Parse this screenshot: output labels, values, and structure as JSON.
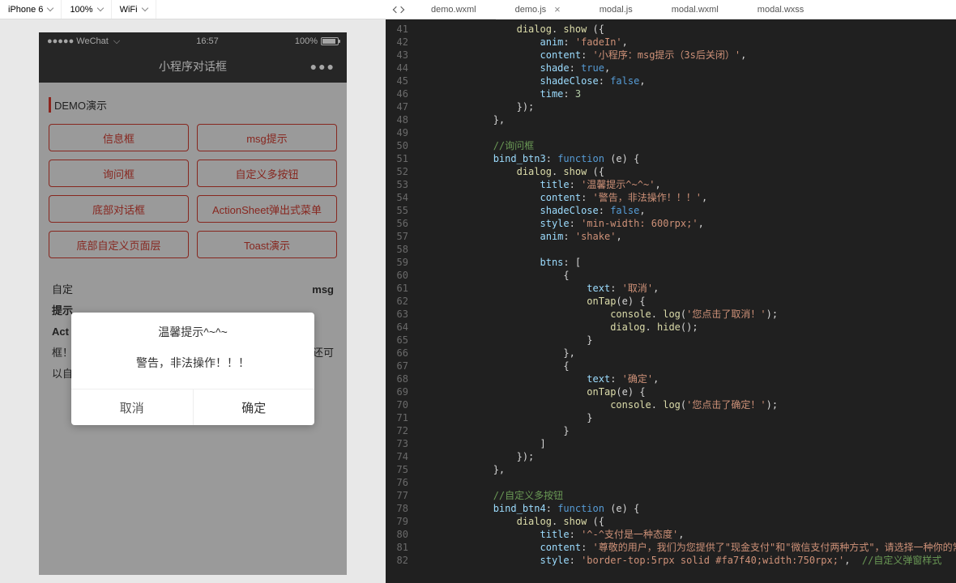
{
  "toolbar": {
    "device": "iPhone 6",
    "zoom": "100%",
    "network": "WiFi"
  },
  "tabs": {
    "items": [
      "demo.wxml",
      "demo.js",
      "modal.js",
      "modal.wxml",
      "modal.wxss"
    ],
    "active": "demo.js",
    "close": "×"
  },
  "phone": {
    "statusbar": {
      "carrier": "●●●●● WeChat",
      "time": "16:57",
      "battery_pct": "100%"
    },
    "nav": {
      "title": "小程序对话框",
      "more": "●●●"
    },
    "section_title": "DEMO演示",
    "buttons": [
      "信息框",
      "msg提示",
      "询问框",
      "自定义多按钮",
      "底部对话框",
      "ActionSheet弹出式菜单",
      "底部自定义页面层",
      "Toast演示"
    ],
    "desc": {
      "l1a": "自定",
      "l1b": "msg",
      "l2a": "提示",
      "l2b": "",
      "l3a": "Act",
      "l3b": "",
      "l4a": "框！",
      "l4b": "还可",
      "l5a": "以自",
      "l5b": ""
    }
  },
  "modal": {
    "title": "温馨提示^~^~",
    "content": "警告，非法操作！！！",
    "cancel": "取消",
    "confirm": "确定"
  },
  "code": {
    "lines": [
      {
        "n": 41,
        "indent": 4,
        "tokens": [
          [
            "fn",
            "dialog"
          ],
          [
            "punc",
            ". "
          ],
          [
            "fn",
            "show"
          ],
          [
            "punc",
            " ({"
          ]
        ]
      },
      {
        "n": 42,
        "indent": 5,
        "tokens": [
          [
            "key",
            "anim"
          ],
          [
            "punc",
            ": "
          ],
          [
            "str",
            "'fadeIn'"
          ],
          [
            "punc",
            ","
          ]
        ]
      },
      {
        "n": 43,
        "indent": 5,
        "tokens": [
          [
            "key",
            "content"
          ],
          [
            "punc",
            ": "
          ],
          [
            "str",
            "'小程序：msg提示（3s后关闭）'"
          ],
          [
            "punc",
            ","
          ]
        ]
      },
      {
        "n": 44,
        "indent": 5,
        "tokens": [
          [
            "key",
            "shade"
          ],
          [
            "punc",
            ": "
          ],
          [
            "bool",
            "true"
          ],
          [
            "punc",
            ","
          ]
        ]
      },
      {
        "n": 45,
        "indent": 5,
        "tokens": [
          [
            "key",
            "shadeClose"
          ],
          [
            "punc",
            ": "
          ],
          [
            "bool",
            "false"
          ],
          [
            "punc",
            ","
          ]
        ]
      },
      {
        "n": 46,
        "indent": 5,
        "tokens": [
          [
            "key",
            "time"
          ],
          [
            "punc",
            ": "
          ],
          [
            "num",
            "3"
          ]
        ]
      },
      {
        "n": 47,
        "indent": 4,
        "tokens": [
          [
            "punc",
            "});"
          ]
        ]
      },
      {
        "n": 48,
        "indent": 3,
        "tokens": [
          [
            "punc",
            "},"
          ]
        ]
      },
      {
        "n": 49,
        "indent": 0,
        "tokens": []
      },
      {
        "n": 50,
        "indent": 3,
        "tokens": [
          [
            "comment",
            "//询问框"
          ]
        ]
      },
      {
        "n": 51,
        "indent": 3,
        "tokens": [
          [
            "key",
            "bind_btn3"
          ],
          [
            "punc",
            ": "
          ],
          [
            "kw",
            "function"
          ],
          [
            "punc",
            " (e) {"
          ]
        ]
      },
      {
        "n": 52,
        "indent": 4,
        "tokens": [
          [
            "fn",
            "dialog"
          ],
          [
            "punc",
            ". "
          ],
          [
            "fn",
            "show"
          ],
          [
            "punc",
            " ({"
          ]
        ]
      },
      {
        "n": 53,
        "indent": 5,
        "tokens": [
          [
            "key",
            "title"
          ],
          [
            "punc",
            ": "
          ],
          [
            "str",
            "'温馨提示^~^~'"
          ],
          [
            "punc",
            ","
          ]
        ]
      },
      {
        "n": 54,
        "indent": 5,
        "tokens": [
          [
            "key",
            "content"
          ],
          [
            "punc",
            ": "
          ],
          [
            "str",
            "'警告，非法操作！！！'"
          ],
          [
            "punc",
            ","
          ]
        ]
      },
      {
        "n": 55,
        "indent": 5,
        "tokens": [
          [
            "key",
            "shadeClose"
          ],
          [
            "punc",
            ": "
          ],
          [
            "bool",
            "false"
          ],
          [
            "punc",
            ","
          ]
        ]
      },
      {
        "n": 56,
        "indent": 5,
        "tokens": [
          [
            "key",
            "style"
          ],
          [
            "punc",
            ": "
          ],
          [
            "str",
            "'min-width: 600rpx;'"
          ],
          [
            "punc",
            ","
          ]
        ]
      },
      {
        "n": 57,
        "indent": 5,
        "tokens": [
          [
            "key",
            "anim"
          ],
          [
            "punc",
            ": "
          ],
          [
            "str",
            "'shake'"
          ],
          [
            "punc",
            ","
          ]
        ]
      },
      {
        "n": 58,
        "indent": 0,
        "tokens": []
      },
      {
        "n": 59,
        "indent": 5,
        "tokens": [
          [
            "key",
            "btns"
          ],
          [
            "punc",
            ": ["
          ]
        ]
      },
      {
        "n": 60,
        "indent": 6,
        "tokens": [
          [
            "punc",
            "{"
          ]
        ]
      },
      {
        "n": 61,
        "indent": 7,
        "tokens": [
          [
            "key",
            "text"
          ],
          [
            "punc",
            ": "
          ],
          [
            "str",
            "'取消'"
          ],
          [
            "punc",
            ","
          ]
        ]
      },
      {
        "n": 62,
        "indent": 7,
        "tokens": [
          [
            "fn",
            "onTap"
          ],
          [
            "punc",
            "(e) {"
          ]
        ]
      },
      {
        "n": 63,
        "indent": 8,
        "tokens": [
          [
            "fn",
            "console"
          ],
          [
            "punc",
            ". "
          ],
          [
            "fn",
            "log"
          ],
          [
            "punc",
            "("
          ],
          [
            "str",
            "'您点击了取消！'"
          ],
          [
            "punc",
            ");"
          ]
        ]
      },
      {
        "n": 64,
        "indent": 8,
        "tokens": [
          [
            "fn",
            "dialog"
          ],
          [
            "punc",
            ". "
          ],
          [
            "fn",
            "hide"
          ],
          [
            "punc",
            "();"
          ]
        ]
      },
      {
        "n": 65,
        "indent": 7,
        "tokens": [
          [
            "punc",
            "}"
          ]
        ]
      },
      {
        "n": 66,
        "indent": 6,
        "tokens": [
          [
            "punc",
            "},"
          ]
        ]
      },
      {
        "n": 67,
        "indent": 6,
        "tokens": [
          [
            "punc",
            "{"
          ]
        ]
      },
      {
        "n": 68,
        "indent": 7,
        "tokens": [
          [
            "key",
            "text"
          ],
          [
            "punc",
            ": "
          ],
          [
            "str",
            "'确定'"
          ],
          [
            "punc",
            ","
          ]
        ]
      },
      {
        "n": 69,
        "indent": 7,
        "tokens": [
          [
            "fn",
            "onTap"
          ],
          [
            "punc",
            "(e) {"
          ]
        ]
      },
      {
        "n": 70,
        "indent": 8,
        "tokens": [
          [
            "fn",
            "console"
          ],
          [
            "punc",
            ". "
          ],
          [
            "fn",
            "log"
          ],
          [
            "punc",
            "("
          ],
          [
            "str",
            "'您点击了确定！'"
          ],
          [
            "punc",
            ");"
          ]
        ]
      },
      {
        "n": 71,
        "indent": 7,
        "tokens": [
          [
            "punc",
            "}"
          ]
        ]
      },
      {
        "n": 72,
        "indent": 6,
        "tokens": [
          [
            "punc",
            "}"
          ]
        ]
      },
      {
        "n": 73,
        "indent": 5,
        "tokens": [
          [
            "punc",
            "]"
          ]
        ]
      },
      {
        "n": 74,
        "indent": 4,
        "tokens": [
          [
            "punc",
            "});"
          ]
        ]
      },
      {
        "n": 75,
        "indent": 3,
        "tokens": [
          [
            "punc",
            "},"
          ]
        ]
      },
      {
        "n": 76,
        "indent": 0,
        "tokens": []
      },
      {
        "n": 77,
        "indent": 3,
        "tokens": [
          [
            "comment",
            "//自定义多按钮"
          ]
        ]
      },
      {
        "n": 78,
        "indent": 3,
        "tokens": [
          [
            "key",
            "bind_btn4"
          ],
          [
            "punc",
            ": "
          ],
          [
            "kw",
            "function"
          ],
          [
            "punc",
            " (e) {"
          ]
        ]
      },
      {
        "n": 79,
        "indent": 4,
        "tokens": [
          [
            "fn",
            "dialog"
          ],
          [
            "punc",
            ". "
          ],
          [
            "fn",
            "show"
          ],
          [
            "punc",
            " ({"
          ]
        ]
      },
      {
        "n": 80,
        "indent": 5,
        "tokens": [
          [
            "key",
            "title"
          ],
          [
            "punc",
            ": "
          ],
          [
            "str",
            "'^-^支付是一种态度'"
          ],
          [
            "punc",
            ","
          ]
        ]
      },
      {
        "n": 81,
        "indent": 5,
        "tokens": [
          [
            "key",
            "content"
          ],
          [
            "punc",
            ": "
          ],
          [
            "str",
            "'尊敬的用户，我们为您提供了\"现金支付\"和\"微信支付两种方式\"，请选择一种你的常用支付方"
          ]
        ]
      },
      {
        "n": 82,
        "indent": 5,
        "tokens": [
          [
            "key",
            "style"
          ],
          [
            "punc",
            ": "
          ],
          [
            "str",
            "'border-top:5rpx solid #fa7f40;width:750rpx;'"
          ],
          [
            "punc",
            ",  "
          ],
          [
            "cm2",
            "//自定义弹窗样式"
          ]
        ]
      }
    ]
  }
}
